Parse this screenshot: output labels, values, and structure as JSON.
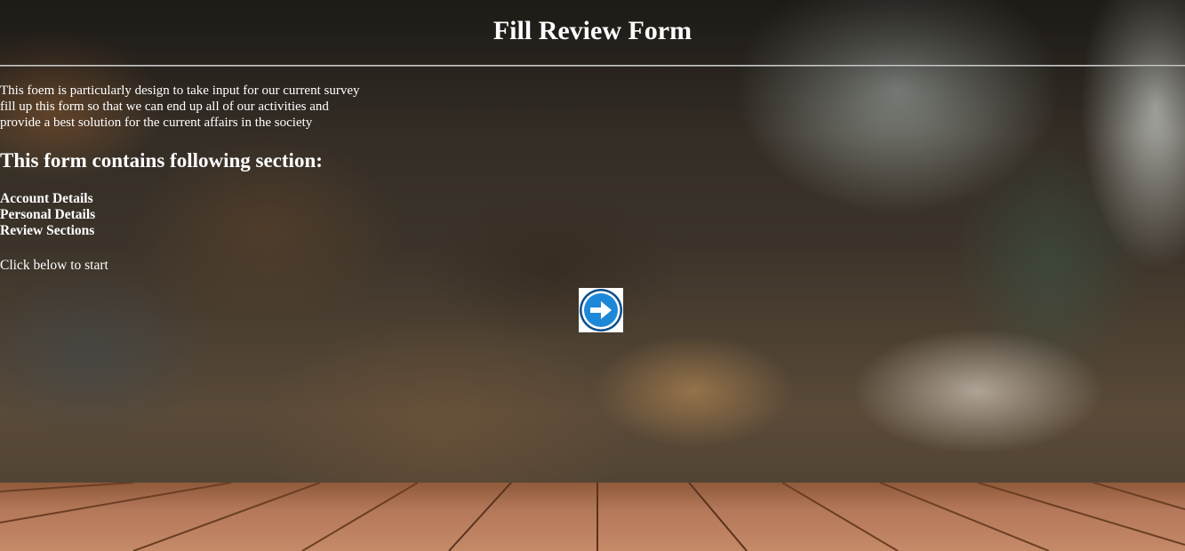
{
  "page": {
    "title": "Fill Review Form"
  },
  "intro": {
    "lines": [
      "This foem is particularly design to take input for our current survey",
      "fill up this form so that we can end up all of our activities and",
      "provide a best solution for the current affairs in the society"
    ]
  },
  "sections": {
    "heading": "This form contains following section:",
    "items": [
      "Account Details",
      "Personal Details",
      "Review Sections"
    ]
  },
  "start": {
    "prompt": "Click below to start",
    "button_icon": "arrow-right-circle-icon"
  },
  "colors": {
    "text": "#ffffff",
    "button_ring": "#0b5fa3",
    "button_fill": "#1e88d8"
  }
}
